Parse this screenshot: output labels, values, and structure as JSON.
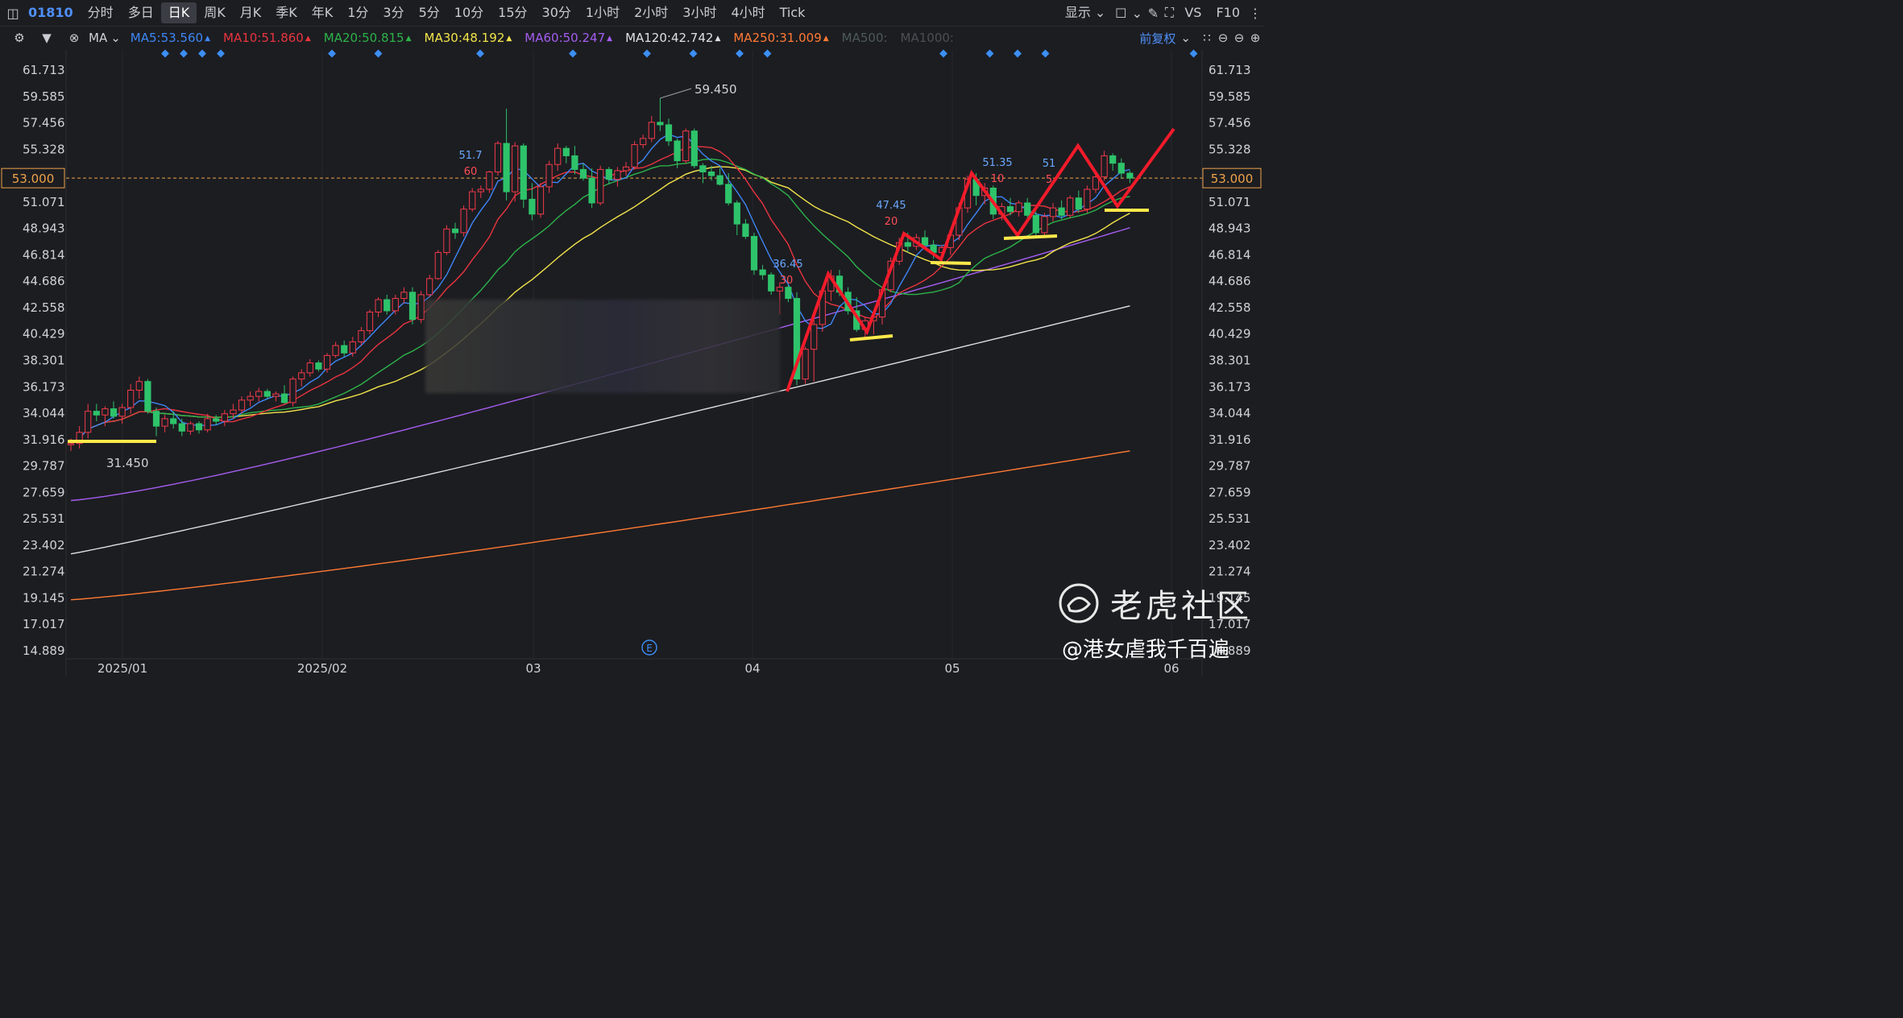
{
  "toolbar": {
    "code": "01810",
    "tabs": [
      "分时",
      "多日",
      "日K",
      "周K",
      "月K",
      "季K",
      "年K",
      "1分",
      "3分",
      "5分",
      "10分",
      "15分",
      "30分",
      "1小时",
      "2小时",
      "3小时",
      "4小时",
      "Tick"
    ],
    "active_tab": "日K",
    "display_label": "显示",
    "vs_label": "VS",
    "f10_label": "F10"
  },
  "ma_bar": {
    "type_label": "MA",
    "items": [
      {
        "label": "MA5:53.560",
        "color": "#3d86f5"
      },
      {
        "label": "MA10:51.860",
        "color": "#e9343f"
      },
      {
        "label": "MA20:50.815",
        "color": "#2cb34a"
      },
      {
        "label": "MA30:48.192",
        "color": "#f2e44a"
      },
      {
        "label": "MA60:50.247",
        "color": "#a55df0"
      },
      {
        "label": "MA120:42.742",
        "color": "#e0e0e0"
      },
      {
        "label": "MA250:31.009",
        "color": "#ff7a33"
      },
      {
        "label": "MA500:",
        "color": "#4d5a5a"
      },
      {
        "label": "MA1000:",
        "color": "#4d4d55"
      }
    ],
    "adjust_label": "前复权"
  },
  "chart_data": {
    "type": "candlestick",
    "y_ticks": [
      "61.713",
      "59.585",
      "57.456",
      "55.328",
      "53.000",
      "51.071",
      "48.943",
      "46.814",
      "44.686",
      "42.558",
      "40.429",
      "38.301",
      "36.173",
      "34.044",
      "31.916",
      "29.787",
      "27.659",
      "25.531",
      "23.402",
      "21.274",
      "19.145",
      "17.017",
      "14.889"
    ],
    "x_ticks": [
      "2025/01",
      "2025/02",
      "03",
      "04",
      "05",
      "06"
    ],
    "current_price": "53.000",
    "high_label": "59.450",
    "low_label": "31.450",
    "annotations": [
      {
        "text": "51.7",
        "color": "#6aa9ff"
      },
      {
        "text": "60",
        "color": "#ff4d57"
      },
      {
        "text": "36.45",
        "color": "#6aa9ff"
      },
      {
        "text": "30",
        "color": "#ff4d57"
      },
      {
        "text": "47.45",
        "color": "#6aa9ff"
      },
      {
        "text": "20",
        "color": "#ff4d57"
      },
      {
        "text": "51.35",
        "color": "#6aa9ff"
      },
      {
        "text": "10",
        "color": "#ff4d57"
      },
      {
        "text": "51",
        "color": "#6aa9ff"
      },
      {
        "text": "5",
        "color": "#ff4d57"
      }
    ],
    "event_marker": "E",
    "ohlc": [
      [
        31.5,
        32.0,
        31.0,
        31.6
      ],
      [
        31.6,
        33.0,
        31.2,
        32.5
      ],
      [
        32.5,
        34.8,
        32.0,
        34.2
      ],
      [
        34.2,
        34.8,
        33.4,
        33.9
      ],
      [
        33.9,
        34.6,
        33.0,
        34.4
      ],
      [
        34.4,
        35.0,
        33.6,
        33.8
      ],
      [
        33.8,
        34.8,
        33.2,
        34.5
      ],
      [
        34.5,
        36.4,
        34.0,
        35.9
      ],
      [
        35.9,
        37.0,
        35.2,
        36.6
      ],
      [
        36.6,
        36.8,
        34.0,
        34.2
      ],
      [
        34.2,
        34.5,
        32.2,
        33.0
      ],
      [
        33.0,
        33.9,
        32.5,
        33.6
      ],
      [
        33.6,
        34.2,
        32.8,
        33.2
      ],
      [
        33.2,
        33.6,
        32.2,
        32.6
      ],
      [
        32.6,
        33.4,
        32.3,
        33.2
      ],
      [
        33.2,
        33.4,
        32.4,
        32.7
      ],
      [
        32.7,
        34.0,
        32.5,
        33.6
      ],
      [
        33.6,
        33.9,
        33.1,
        33.4
      ],
      [
        33.4,
        34.3,
        33.0,
        34.0
      ],
      [
        34.0,
        34.8,
        33.6,
        34.3
      ],
      [
        34.3,
        35.4,
        34.0,
        35.1
      ],
      [
        35.1,
        35.8,
        34.6,
        35.4
      ],
      [
        35.4,
        36.1,
        35.0,
        35.8
      ],
      [
        35.8,
        36.0,
        35.2,
        35.4
      ],
      [
        35.4,
        35.8,
        35.0,
        35.6
      ],
      [
        35.6,
        36.3,
        34.8,
        34.9
      ],
      [
        34.9,
        37.0,
        34.6,
        36.8
      ],
      [
        36.8,
        37.6,
        36.2,
        37.3
      ],
      [
        37.3,
        38.4,
        37.0,
        38.1
      ],
      [
        38.1,
        38.3,
        37.4,
        37.6
      ],
      [
        37.6,
        38.9,
        37.3,
        38.7
      ],
      [
        38.7,
        39.8,
        38.5,
        39.5
      ],
      [
        39.5,
        39.9,
        38.6,
        38.9
      ],
      [
        38.9,
        40.2,
        38.6,
        39.8
      ],
      [
        39.8,
        41.0,
        39.5,
        40.7
      ],
      [
        40.7,
        42.4,
        40.4,
        42.2
      ],
      [
        42.2,
        43.4,
        41.8,
        43.2
      ],
      [
        43.2,
        43.6,
        42.0,
        42.3
      ],
      [
        42.3,
        43.6,
        42.0,
        43.3
      ],
      [
        43.3,
        44.2,
        42.9,
        43.8
      ],
      [
        43.8,
        44.2,
        41.2,
        41.6
      ],
      [
        41.6,
        43.9,
        41.3,
        43.6
      ],
      [
        43.6,
        45.2,
        43.4,
        44.9
      ],
      [
        44.9,
        47.2,
        44.8,
        47.0
      ],
      [
        47.0,
        49.2,
        46.8,
        48.9
      ],
      [
        48.9,
        49.4,
        48.1,
        48.6
      ],
      [
        48.6,
        50.8,
        48.3,
        50.5
      ],
      [
        50.5,
        52.2,
        50.3,
        51.9
      ],
      [
        51.9,
        52.4,
        51.4,
        52.1
      ],
      [
        52.1,
        53.6,
        51.8,
        53.5
      ],
      [
        53.5,
        56.0,
        53.2,
        55.8
      ],
      [
        55.8,
        58.6,
        51.2,
        51.9
      ],
      [
        51.9,
        55.9,
        51.1,
        55.6
      ],
      [
        55.6,
        55.8,
        50.6,
        51.3
      ],
      [
        51.3,
        52.6,
        49.6,
        50.1
      ],
      [
        50.1,
        52.6,
        49.8,
        52.3
      ],
      [
        52.3,
        54.4,
        51.8,
        54.1
      ],
      [
        54.1,
        55.8,
        53.6,
        55.4
      ],
      [
        55.4,
        55.6,
        54.2,
        54.8
      ],
      [
        54.8,
        55.6,
        53.3,
        53.7
      ],
      [
        53.7,
        54.2,
        52.8,
        53.0
      ],
      [
        53.0,
        53.8,
        50.6,
        51.0
      ],
      [
        51.0,
        54.0,
        50.8,
        53.7
      ],
      [
        53.7,
        53.9,
        52.5,
        52.9
      ],
      [
        52.9,
        53.9,
        52.3,
        53.6
      ],
      [
        53.6,
        54.3,
        53.2,
        53.9
      ],
      [
        53.9,
        56.0,
        53.7,
        55.7
      ],
      [
        55.7,
        56.5,
        55.4,
        56.2
      ],
      [
        56.2,
        58.0,
        55.9,
        57.5
      ],
      [
        57.5,
        59.45,
        56.8,
        57.3
      ],
      [
        57.3,
        57.8,
        55.6,
        56.0
      ],
      [
        56.0,
        56.2,
        53.8,
        54.4
      ],
      [
        54.4,
        57.0,
        54.2,
        56.8
      ],
      [
        56.8,
        57.0,
        53.8,
        54.0
      ],
      [
        54.0,
        54.2,
        52.6,
        53.5
      ],
      [
        53.5,
        54.0,
        52.8,
        53.2
      ],
      [
        53.2,
        53.8,
        52.4,
        52.5
      ],
      [
        52.5,
        53.4,
        50.8,
        51.0
      ],
      [
        51.0,
        51.2,
        48.4,
        49.3
      ],
      [
        49.3,
        49.7,
        48.1,
        48.3
      ],
      [
        48.3,
        48.6,
        45.2,
        45.6
      ],
      [
        45.6,
        46.0,
        44.8,
        45.2
      ],
      [
        45.2,
        45.4,
        43.6,
        43.9
      ],
      [
        43.9,
        44.6,
        42.0,
        44.2
      ],
      [
        44.2,
        44.4,
        43.0,
        43.3
      ],
      [
        43.3,
        43.8,
        36.3,
        36.8
      ],
      [
        36.8,
        39.4,
        36.4,
        39.2
      ],
      [
        39.2,
        41.6,
        36.6,
        41.2
      ],
      [
        41.2,
        44.1,
        40.6,
        43.9
      ],
      [
        43.9,
        45.6,
        43.1,
        45.1
      ],
      [
        45.1,
        45.6,
        43.5,
        43.8
      ],
      [
        43.8,
        44.2,
        42.0,
        42.3
      ],
      [
        42.3,
        43.4,
        40.6,
        40.8
      ],
      [
        40.8,
        41.8,
        40.0,
        41.5
      ],
      [
        41.5,
        42.2,
        40.4,
        41.8
      ],
      [
        41.8,
        44.2,
        41.2,
        44.0
      ],
      [
        44.0,
        46.6,
        43.8,
        46.3
      ],
      [
        46.3,
        48.2,
        46.0,
        47.8
      ],
      [
        47.8,
        48.6,
        47.0,
        47.5
      ],
      [
        47.5,
        48.5,
        47.2,
        48.2
      ],
      [
        48.2,
        48.8,
        47.4,
        47.6
      ],
      [
        47.6,
        48.0,
        46.5,
        47.0
      ],
      [
        47.0,
        47.6,
        46.4,
        47.4
      ],
      [
        47.4,
        48.6,
        46.8,
        48.4
      ],
      [
        48.4,
        51.0,
        48.0,
        50.6
      ],
      [
        50.6,
        53.2,
        50.2,
        52.9
      ],
      [
        52.9,
        53.4,
        50.8,
        51.6
      ],
      [
        51.6,
        52.6,
        50.9,
        52.2
      ],
      [
        52.2,
        52.4,
        49.7,
        50.1
      ],
      [
        50.1,
        51.0,
        49.6,
        50.7
      ],
      [
        50.7,
        51.4,
        50.0,
        50.3
      ],
      [
        50.3,
        51.2,
        49.9,
        51.0
      ],
      [
        51.0,
        51.4,
        49.8,
        50.0
      ],
      [
        50.0,
        50.3,
        48.2,
        48.6
      ],
      [
        48.6,
        50.2,
        48.4,
        49.9
      ],
      [
        49.9,
        51.0,
        49.5,
        50.6
      ],
      [
        50.6,
        51.2,
        49.7,
        50.0
      ],
      [
        50.0,
        51.6,
        49.8,
        51.4
      ],
      [
        51.4,
        52.0,
        50.2,
        50.5
      ],
      [
        50.5,
        52.4,
        50.2,
        52.1
      ],
      [
        52.1,
        53.4,
        51.8,
        53.1
      ],
      [
        53.1,
        55.2,
        52.8,
        54.8
      ],
      [
        54.8,
        55.0,
        53.6,
        54.2
      ],
      [
        54.2,
        54.6,
        53.0,
        53.4
      ],
      [
        53.4,
        53.6,
        52.6,
        53.0
      ]
    ]
  },
  "watermark": {
    "brand": "老虎社区",
    "handle": "@港女虐我千百遍"
  }
}
